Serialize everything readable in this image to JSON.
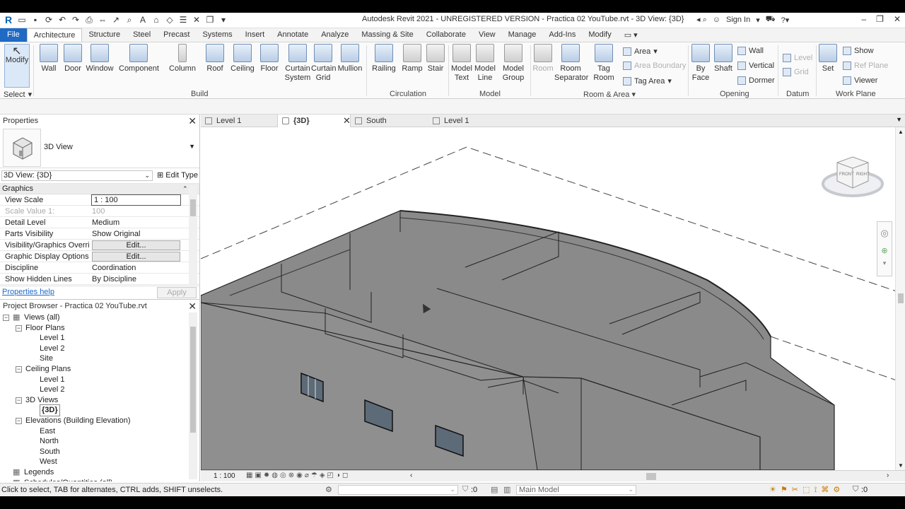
{
  "titlebar": {
    "title": "Autodesk Revit 2021 - UNREGISTERED VERSION - Practica 02 YouTube.rvt - 3D View: {3D}",
    "sign_in": "Sign In"
  },
  "menu": {
    "file": "File",
    "tabs": [
      "Architecture",
      "Structure",
      "Steel",
      "Precast",
      "Systems",
      "Insert",
      "Annotate",
      "Analyze",
      "Massing & Site",
      "Collaborate",
      "View",
      "Manage",
      "Add-Ins",
      "Modify"
    ]
  },
  "ribbon": {
    "modify": "Modify",
    "select": "Select",
    "build": [
      "Wall",
      "Door",
      "Window",
      "Component",
      "Column",
      "Roof",
      "Ceiling",
      "Floor",
      "Curtain System",
      "Curtain Grid",
      "Mullion"
    ],
    "build_label": "Build",
    "circulation": [
      "Railing",
      "Ramp",
      "Stair"
    ],
    "circulation_label": "Circulation",
    "model": [
      "Model Text",
      "Model Line",
      "Model Group"
    ],
    "model_label": "Model",
    "room": [
      "Room",
      "Room Separator",
      "Tag Room"
    ],
    "room_small": [
      "Area",
      "Area Boundary",
      "Tag Area"
    ],
    "room_label": "Room & Area",
    "opening": [
      "By Face",
      "Shaft"
    ],
    "opening_small": [
      "Wall",
      "Vertical",
      "Dormer"
    ],
    "opening_label": "Opening",
    "datum_small": [
      "Level",
      "Grid"
    ],
    "datum_label": "Datum",
    "workplane": "Set",
    "workplane_small": [
      "Show",
      "Ref Plane",
      "Viewer"
    ],
    "workplane_label": "Work Plane"
  },
  "properties": {
    "title": "Properties",
    "type_name": "3D View",
    "instance": "3D View: {3D}",
    "edit_type": "Edit Type",
    "group": "Graphics",
    "rows": [
      {
        "k": "View Scale",
        "v": "1 : 100"
      },
      {
        "k": "Scale Value    1:",
        "v": "100"
      },
      {
        "k": "Detail Level",
        "v": "Medium"
      },
      {
        "k": "Parts Visibility",
        "v": "Show Original"
      },
      {
        "k": "Visibility/Graphics Overri...",
        "v": "Edit..."
      },
      {
        "k": "Graphic Display Options",
        "v": "Edit..."
      },
      {
        "k": "Discipline",
        "v": "Coordination"
      },
      {
        "k": "Show Hidden Lines",
        "v": "By Discipline"
      }
    ],
    "help": "Properties help",
    "apply": "Apply"
  },
  "browser": {
    "title": "Project Browser - Practica 02 YouTube.rvt",
    "nodes": [
      {
        "label": "Views (all)",
        "level": 0,
        "toggle": "−"
      },
      {
        "label": "Floor Plans",
        "level": 1,
        "toggle": "−"
      },
      {
        "label": "Level 1",
        "level": 2
      },
      {
        "label": "Level 2",
        "level": 2
      },
      {
        "label": "Site",
        "level": 2
      },
      {
        "label": "Ceiling Plans",
        "level": 1,
        "toggle": "−"
      },
      {
        "label": "Level 1",
        "level": 2
      },
      {
        "label": "Level 2",
        "level": 2
      },
      {
        "label": "3D Views",
        "level": 1,
        "toggle": "−"
      },
      {
        "label": "{3D}",
        "level": 2,
        "selected": true
      },
      {
        "label": "Elevations (Building Elevation)",
        "level": 1,
        "toggle": "−"
      },
      {
        "label": "East",
        "level": 2
      },
      {
        "label": "North",
        "level": 2
      },
      {
        "label": "South",
        "level": 2
      },
      {
        "label": "West",
        "level": 2
      },
      {
        "label": "Legends",
        "level": 0
      },
      {
        "label": "Schedules/Quantities (all)",
        "level": 0
      }
    ]
  },
  "view_tabs": [
    {
      "label": "Level 1",
      "active": false
    },
    {
      "label": "{3D}",
      "active": true
    },
    {
      "label": "South",
      "active": false
    },
    {
      "label": "Level 1",
      "active": false
    }
  ],
  "view_control": {
    "scale": "1 : 100"
  },
  "viewcube": {
    "front": "FRONT",
    "right": "RIGHT"
  },
  "status": {
    "hint": "Click to select, TAB for alternates, CTRL adds, SHIFT unselects.",
    "filter_count": ":0",
    "model": "Main Model",
    "select_count": ":0"
  },
  "colors": {
    "accent": "#1f6ac4",
    "model_gray": "#8a8a8a"
  }
}
